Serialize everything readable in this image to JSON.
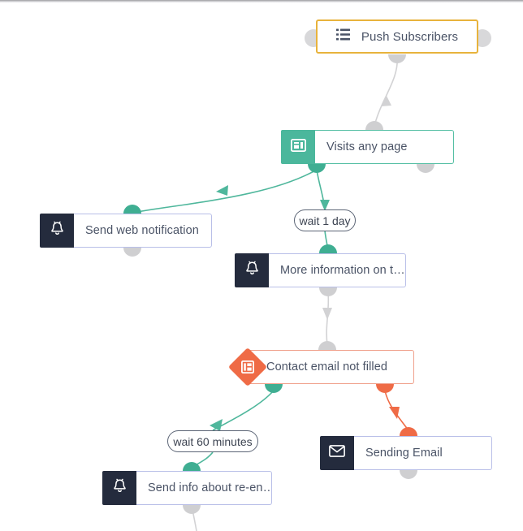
{
  "app": {
    "canvas_name": "workflow-automation-canvas",
    "background_color": "#ffffff"
  },
  "colors": {
    "trigger_border": "#e8b33c",
    "event_accent": "#4bb79c",
    "event_border": "#54bfa4",
    "action_icon_bg": "#242b3d",
    "action_border": "#b9bfe8",
    "condition_accent": "#ef6b46",
    "condition_border": "#f0a18c",
    "port_gray": "#cfcfd1",
    "port_teal": "#3fae92",
    "port_orange": "#ef6b46",
    "edge_gray": "#d2d2d4",
    "edge_teal": "#4fb79c",
    "edge_orange": "#ef6b46",
    "label_text": "#4a5366"
  },
  "nodes": {
    "push_subscribers": {
      "label": "Push Subscribers",
      "icon": "list-icon",
      "type": "trigger"
    },
    "visits_any_page": {
      "label": "Visits any page",
      "icon": "browser-window-icon",
      "type": "event"
    },
    "send_web_notification": {
      "label": "Send web notification",
      "icon": "bell-icon",
      "type": "action"
    },
    "more_information": {
      "label": "More information on t…",
      "icon": "bell-icon",
      "type": "action"
    },
    "contact_email_not_filled": {
      "label": "Contact email not filled",
      "icon": "condition-layout-icon",
      "type": "condition"
    },
    "sending_email": {
      "label": "Sending Email",
      "icon": "envelope-icon",
      "type": "action"
    },
    "send_info_re_engagement": {
      "label": "Send info about re-en…",
      "icon": "bell-icon",
      "type": "action"
    }
  },
  "delays": {
    "wait_1_day": {
      "label": "wait 1 day"
    },
    "wait_60_minutes": {
      "label": "wait 60 minutes"
    }
  }
}
